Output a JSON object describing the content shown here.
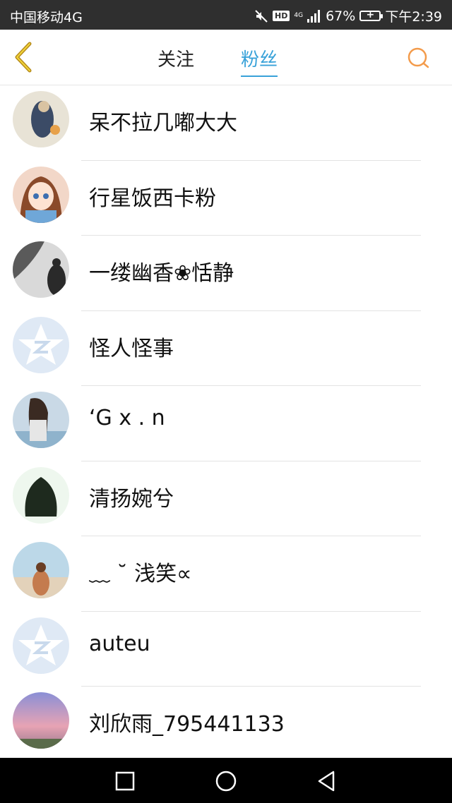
{
  "status_bar": {
    "carrier": "中国移动4G",
    "network": "4G",
    "hd": "HD",
    "battery": "67%",
    "time": "下午2:39"
  },
  "header": {
    "tabs": [
      {
        "label": "关注",
        "active": false
      },
      {
        "label": "粉丝",
        "active": true
      }
    ],
    "accent_color": "#39a2d9",
    "back_icon_color": "#b58a1a",
    "search_icon_color": "#f39b4b"
  },
  "fans": [
    {
      "name": "呆不拉几嘟大大",
      "avatar": "photo-avatar"
    },
    {
      "name": "行星饭西卡粉",
      "avatar": "anime-girl-avatar"
    },
    {
      "name": "一缕幽香❀恬静",
      "avatar": "grayscale-photo-avatar"
    },
    {
      "name": "怪人怪事",
      "avatar": "default-qzone-avatar"
    },
    {
      "name": "‘G x . n",
      "avatar": "photo-avatar"
    },
    {
      "name": "清扬婉兮",
      "avatar": "photo-avatar"
    },
    {
      "name": "﹏ ˘ 浅笑∝",
      "avatar": "photo-avatar"
    },
    {
      "name": "auteu",
      "avatar": "default-qzone-avatar"
    },
    {
      "name": "刘欣雨_795441133",
      "avatar": "sunset-photo-avatar"
    }
  ]
}
